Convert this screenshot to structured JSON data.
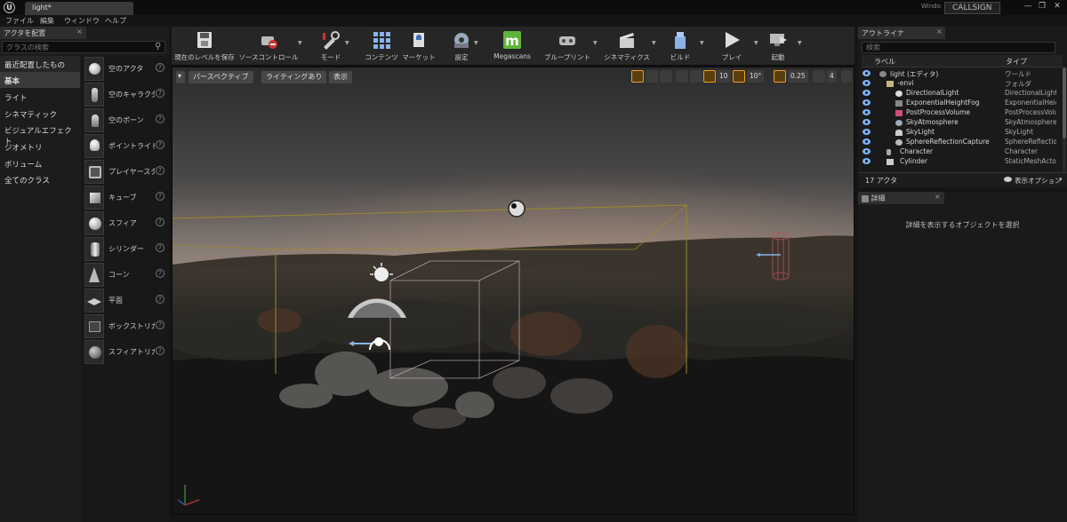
{
  "window": {
    "tab_title": "light*",
    "logo": "U",
    "window_label": "Windo",
    "callsign": "CALLSIGN",
    "controls": [
      "—",
      "❐",
      "✕"
    ]
  },
  "menubar": [
    "ファイル",
    "編集",
    "ウィンドウ",
    "ヘルプ"
  ],
  "toolbar": [
    {
      "label": "現在のレベルを保存",
      "icon": "save-icon",
      "dropdown": false
    },
    {
      "label": "ソースコントロール",
      "icon": "source-control-icon",
      "dropdown": true
    },
    {
      "label": "モード",
      "icon": "modes-icon",
      "dropdown": true
    },
    {
      "label": "コンテンツ",
      "icon": "content-icon",
      "dropdown": false
    },
    {
      "label": "マーケット",
      "icon": "marketplace-icon",
      "dropdown": false
    },
    {
      "label": "設定",
      "icon": "settings-icon",
      "dropdown": true
    },
    {
      "label": "Megascans",
      "icon": "megascans-icon",
      "dropdown": false
    },
    {
      "label": "ブループリント",
      "icon": "blueprint-icon",
      "dropdown": true
    },
    {
      "label": "シネマティクス",
      "icon": "cinematics-icon",
      "dropdown": true
    },
    {
      "label": "ビルド",
      "icon": "build-icon",
      "dropdown": true
    },
    {
      "label": "プレイ",
      "icon": "play-icon",
      "dropdown": true
    },
    {
      "label": "起動",
      "icon": "launch-icon",
      "dropdown": true
    }
  ],
  "place_actors": {
    "tab": "アクタを配置",
    "close": "×",
    "search_placeholder": "クラスの検索",
    "categories": [
      "最近配置したもの",
      "基本",
      "ライト",
      "シネマティック",
      "ビジュアルエフェクト",
      "ジオメトリ",
      "ボリューム",
      "全てのクラス"
    ],
    "selected_category": "基本",
    "items": [
      {
        "label": "空のアクタ",
        "icon": "sphere-icon"
      },
      {
        "label": "空のキャラクタ",
        "icon": "character-icon"
      },
      {
        "label": "空のポーン",
        "icon": "pawn-icon"
      },
      {
        "label": "ポイントライト",
        "icon": "lightbulb-icon"
      },
      {
        "label": "プレイヤースタート",
        "icon": "player-start-icon"
      },
      {
        "label": "キューブ",
        "icon": "cube-icon"
      },
      {
        "label": "スフィア",
        "icon": "sphere-icon"
      },
      {
        "label": "シリンダー",
        "icon": "cylinder-icon"
      },
      {
        "label": "コーン",
        "icon": "cone-icon"
      },
      {
        "label": "平面",
        "icon": "plane-icon"
      },
      {
        "label": "ボックストリガー",
        "icon": "box-trigger-icon"
      },
      {
        "label": "スフィアトリガー",
        "icon": "sphere-trigger-icon"
      }
    ],
    "help": "?"
  },
  "viewport": {
    "menu": "▾",
    "perspective": "パースペクティブ",
    "lit": "ライティングあり",
    "show": "表示",
    "grid_snap": "10",
    "rotation_snap": "10°",
    "scale_snap": "0.25",
    "camera_speed": "4"
  },
  "outliner": {
    "tab": "アウトライナ",
    "close": "×",
    "search_placeholder": "検索",
    "col_label": "ラベル",
    "col_type": "タイプ",
    "rows": [
      {
        "name": "light (エディタ)",
        "type": "ワールド",
        "indent": 0
      },
      {
        "name": "-envi",
        "type": "フォルダ",
        "indent": 1
      },
      {
        "name": "DirectionalLight",
        "type": "DirectionalLight",
        "indent": 2
      },
      {
        "name": "ExponentialHeightFog",
        "type": "ExponentialHeightFog",
        "indent": 2
      },
      {
        "name": "PostProcessVolume",
        "type": "PostProcessVolume",
        "indent": 2
      },
      {
        "name": "SkyAtmosphere",
        "type": "SkyAtmosphere",
        "indent": 2
      },
      {
        "name": "SkyLight",
        "type": "SkyLight",
        "indent": 2
      },
      {
        "name": "SphereReflectionCapture",
        "type": "SphereReflectionCapture",
        "indent": 2
      },
      {
        "name": "Character",
        "type": "Character",
        "indent": 1
      },
      {
        "name": "Cylinder",
        "type": "StaticMeshActor",
        "indent": 1
      }
    ],
    "count": "17 アクタ",
    "view_options": "表示オプション"
  },
  "details": {
    "tab": "詳細",
    "close": "×",
    "empty_text": "詳細を表示するオブジェクトを選択"
  },
  "colors": {
    "accent": "#f0a020",
    "eye": "#7bb3ff",
    "panel": "#1c1c1c",
    "header": "#2e2e2e"
  }
}
